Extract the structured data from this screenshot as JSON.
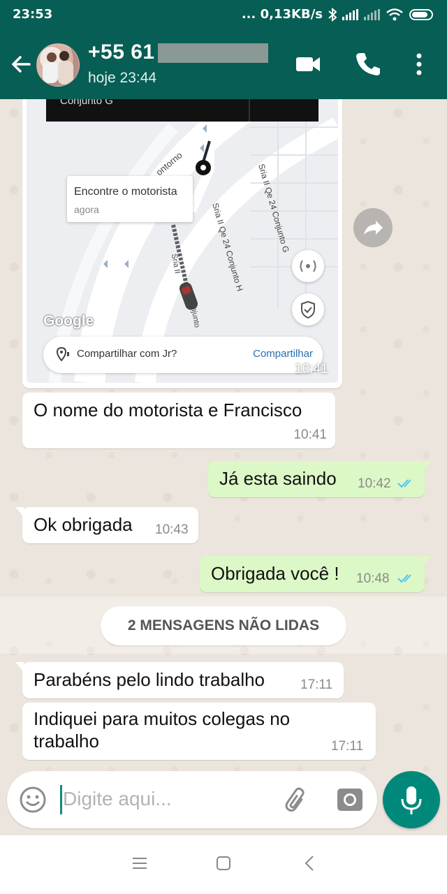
{
  "status_bar": {
    "time": "23:53",
    "network_speed": "... 0,13KB/s"
  },
  "header": {
    "contact_name": "+55 61",
    "last_seen": "hoje 23:44",
    "icons": [
      "back-arrow-icon",
      "avatar",
      "video-call-icon",
      "phone-call-icon",
      "more-vert-icon"
    ]
  },
  "map_message": {
    "top_label": "Conjunto G",
    "callout_title": "Encontre o motorista",
    "callout_sub": "agora",
    "street_labels": [
      "ontorno",
      "Sria II Qe 24 Conjunto H",
      "Sria II Qe 24 Conjunto G",
      "Sria II",
      "njunto"
    ],
    "google_logo": "Google",
    "share_text": "Compartilhar com Jr?",
    "share_action": "Compartilhar",
    "time": "10:41"
  },
  "messages": [
    {
      "dir": "in",
      "text": "O nome do motorista e Francisco",
      "time": "10:41"
    },
    {
      "dir": "out",
      "text": "Já esta saindo",
      "time": "10:42",
      "status": "read"
    },
    {
      "dir": "in",
      "text": "Ok obrigada",
      "time": "10:43"
    },
    {
      "dir": "out",
      "text": "Obrigada você !",
      "time": "10:48",
      "status": "read"
    },
    {
      "dir": "in",
      "text": "Parabéns pelo lindo trabalho",
      "time": "17:11"
    },
    {
      "dir": "in",
      "text_line1": "Indiquei para muitos colegas no",
      "text_line2": "trabalho",
      "time": "17:11"
    }
  ],
  "unread_banner": "2 MENSAGENS NÃO LIDAS",
  "input": {
    "placeholder": "Digite aqui..."
  },
  "colors": {
    "header": "#075E54",
    "outgoing_bubble": "#DCF8C6",
    "mic_button": "#00897B",
    "read_ticks": "#4FC3F7"
  }
}
